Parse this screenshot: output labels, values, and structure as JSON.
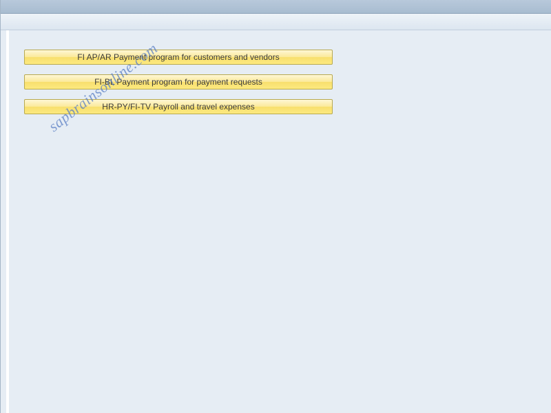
{
  "buttons": [
    {
      "label": "FI AP/AR Payment program for customers and vendors"
    },
    {
      "label": "FI-BL Payment program for payment requests"
    },
    {
      "label": "HR-PY/FI-TV Payroll and travel expenses"
    }
  ],
  "watermark": "sapbrainsonline.com"
}
